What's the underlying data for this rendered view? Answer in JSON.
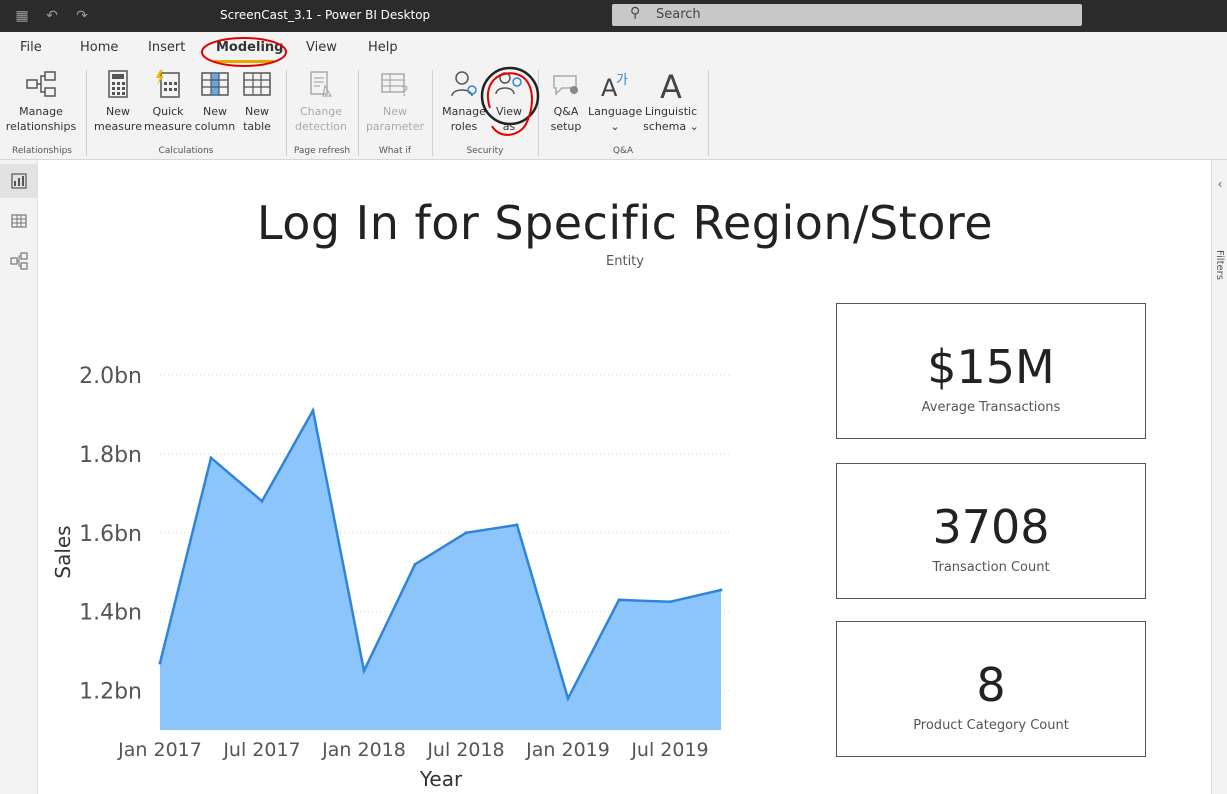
{
  "titlebar": {
    "title": "ScreenCast_3.1 - Power BI Desktop",
    "search_placeholder": "Search"
  },
  "menu": [
    "File",
    "Home",
    "Insert",
    "Modeling",
    "View",
    "Help"
  ],
  "ribbon": {
    "buttons": [
      {
        "l1": "Manage",
        "l2": "relationships"
      },
      {
        "l1": "New",
        "l2": "measure"
      },
      {
        "l1": "Quick",
        "l2": "measure"
      },
      {
        "l1": "New",
        "l2": "column"
      },
      {
        "l1": "New",
        "l2": "table"
      },
      {
        "l1": "Change",
        "l2": "detection"
      },
      {
        "l1": "New",
        "l2": "parameter"
      },
      {
        "l1": "Manage",
        "l2": "roles"
      },
      {
        "l1": "View",
        "l2": "as"
      },
      {
        "l1": "Q&A",
        "l2": "setup"
      },
      {
        "l1": "Language",
        "l2": "⌄"
      },
      {
        "l1": "Linguistic",
        "l2": "schema ⌄"
      }
    ],
    "groups": [
      "Relationships",
      "Calculations",
      "Page refresh",
      "What if",
      "Security",
      "Q&A"
    ]
  },
  "report": {
    "title": "Log In for Specific Region/Store",
    "subtitle": "Entity",
    "cards": [
      {
        "value": "$15M",
        "label": "Average Transactions"
      },
      {
        "value": "3708",
        "label": "Transaction Count"
      },
      {
        "value": "8",
        "label": "Product Category Count"
      }
    ]
  },
  "rightpane": {
    "label": "Filters"
  },
  "chart_data": {
    "type": "area",
    "xlabel": "Year",
    "ylabel": "Sales",
    "x": [
      "2017-01",
      "2017-04",
      "2017-07",
      "2017-10",
      "2018-01",
      "2018-04",
      "2018-07",
      "2018-10",
      "2019-01",
      "2019-04",
      "2019-07",
      "2019-10"
    ],
    "values": [
      1.27,
      1.79,
      1.68,
      1.91,
      1.25,
      1.52,
      1.6,
      1.62,
      1.18,
      1.43,
      1.425,
      1.455
    ],
    "ylim": [
      1.1,
      2.0
    ],
    "yticks": [
      1.2,
      1.4,
      1.6,
      1.8,
      2.0
    ],
    "ytick_labels": [
      "1.2bn",
      "1.4bn",
      "1.6bn",
      "1.8bn",
      "2.0bn"
    ],
    "xtick_labels": [
      "Jan 2017",
      "Jul 2017",
      "Jan 2018",
      "Jul 2018",
      "Jan 2019",
      "Jul 2019"
    ],
    "xtick_index": [
      0,
      2,
      4,
      6,
      8,
      10
    ],
    "colors": {
      "fill": "#8cc5fb",
      "line": "#2f84d8"
    },
    "grid": true
  }
}
